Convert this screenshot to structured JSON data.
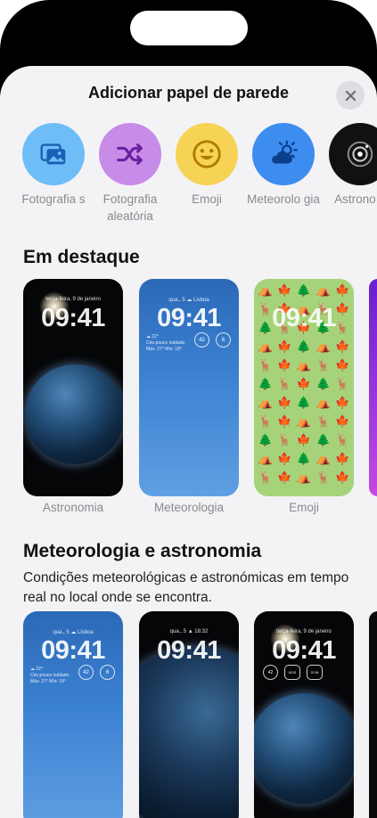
{
  "sheet": {
    "title": "Adicionar papel de parede"
  },
  "categories": [
    {
      "label": "Fotografia s",
      "icon": "photos-icon",
      "color": "#6fbdf7"
    },
    {
      "label": "Fotografia aleatória",
      "icon": "shuffle-icon",
      "color": "#c78be8"
    },
    {
      "label": "Emoji",
      "icon": "smiley-icon",
      "color": "#f6d354"
    },
    {
      "label": "Meteorolo gia",
      "icon": "weather-icon",
      "color": "#3d8cf0"
    },
    {
      "label": "Astrono a",
      "icon": "astronomy-icon",
      "color": "#111111"
    }
  ],
  "featured": {
    "title": "Em destaque",
    "cards": [
      {
        "label": "Astronomia",
        "date": "terça-feira, 9 de janeiro",
        "time": "09:41"
      },
      {
        "label": "Meteorologia",
        "date": "qua., 5 ☁ Lisboa",
        "time": "09:41",
        "weather_line1": "☁ 22°",
        "weather_line2": "Céu pouco nublado",
        "weather_line3": "Máx: 27° Mín: 18°",
        "gauge1": "42",
        "gauge2": "6"
      },
      {
        "label": "Emoji",
        "time": "09:41"
      }
    ]
  },
  "weather_astro": {
    "title": "Meteorologia e astronomia",
    "description": "Condições meteorológicas e astronómicas em tempo real no local onde se encontra.",
    "cards": [
      {
        "date": "qua., 5 ☁ Lisboa",
        "time": "09:41",
        "weather_line1": "☁ 22°",
        "weather_line2": "Céu pouco nublado",
        "weather_line3": "Máx: 27° Mín: 18°",
        "gauge1": "42",
        "gauge2": "6"
      },
      {
        "date": "qua., 5 ▲ 18:32",
        "time": "09:41"
      },
      {
        "date": "terça-feira, 9 de janeiro",
        "time": "09:41",
        "gauge1": "42",
        "gauge2": "18:32",
        "gauge3": "07:06"
      }
    ]
  }
}
